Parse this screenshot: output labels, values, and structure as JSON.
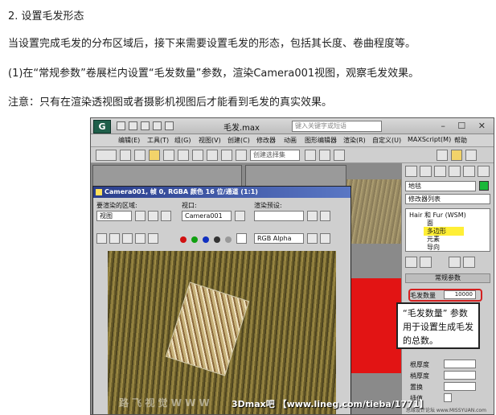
{
  "article": {
    "heading": "2. 设置毛发形态",
    "para1": "当设置完成毛发的分布区域后，接下来需要设置毛发的形态，包括其长度、卷曲程度等。",
    "para2": "(1)在“常规参数”卷展栏内设置“毛发数量”参数，渲染Camera001视图，观察毛发效果。",
    "para3": "注意：只有在渲染透视图或者摄影机视图后才能看到毛发的真实效果。"
  },
  "screenshot": {
    "app_title": "毛发.max",
    "search_placeholder": "键入关键字或短语",
    "menu": [
      "编辑(E)",
      "工具(T)",
      "组(G)",
      "视图(V)",
      "创建(C)",
      "修改器",
      "动画",
      "图形编辑器",
      "渲染(R)",
      "自定义(U)",
      "MAXScript(M)",
      "帮助"
    ],
    "selection_set_placeholder": "创建选择集",
    "render_window": {
      "title": "Camera001, 帧 0, RGBA 颜色 16 位/通道 (1:1)",
      "area_label": "要渲染的区域:",
      "area_value": "视图",
      "viewport_label": "视口:",
      "viewport_value": "Camera001",
      "preset_label": "渲染预设:",
      "channel_value": "RGB Alpha",
      "swatches": [
        "#d01010",
        "#10a010",
        "#1030c0"
      ]
    },
    "command_panel": {
      "object_name": "地毯",
      "modifier_list": "修改器列表",
      "stack": [
        "Hair 和 Fur (WSM)",
        "面",
        "多边形",
        "元素",
        "导向"
      ],
      "stack_selected_index": 2,
      "rollout_title": "常规参数",
      "params": [
        {
          "label": "毛发数量",
          "value": "10000"
        },
        {
          "label": "根厚度",
          "value": ""
        },
        {
          "label": "梢厚度",
          "value": ""
        },
        {
          "label": "置换",
          "value": ""
        },
        {
          "label": "插值",
          "value": ""
        }
      ],
      "accent_green": "#19b83a"
    },
    "callout": {
      "line1": "“毛发数量” 参数",
      "line2": "用于设置生成毛发",
      "line3": "的总数。"
    },
    "watermark_left": "路 飞 视 觉 W W W",
    "watermark": "3Dmax吧 【www.lineg.com/tieba/1771】",
    "footer_mark": "思缘设计论坛 www.MISSYUAN.com"
  }
}
